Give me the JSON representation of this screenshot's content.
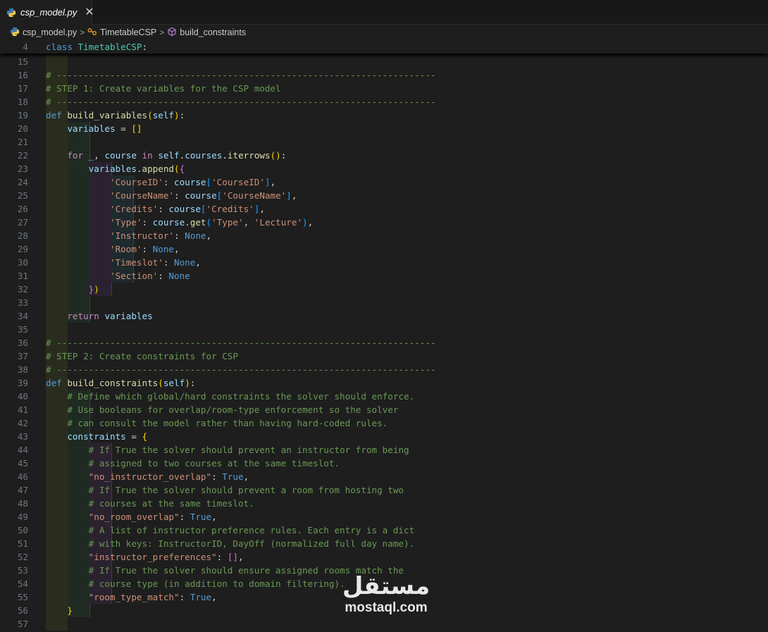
{
  "tab": {
    "label": "csp_model.py",
    "close": "✕"
  },
  "breadcrumb": {
    "file": "csp_model.py",
    "class": "TimetableCSP",
    "method": "build_constraints",
    "separator": ">"
  },
  "sticky": {
    "line": "4",
    "tokens": [
      {
        "t": "class",
        "c": "kw"
      },
      {
        "t": " ",
        "c": "plain"
      },
      {
        "t": "TimetableCSP",
        "c": "cls"
      },
      {
        "t": ":",
        "c": "plain"
      }
    ]
  },
  "editor": {
    "lines": [
      {
        "n": "15",
        "bands": [
          1
        ],
        "tokens": []
      },
      {
        "n": "16",
        "bands": [
          1
        ],
        "tokens": [
          {
            "t": "# -----------------------------------------------------------------------",
            "c": "cm"
          }
        ]
      },
      {
        "n": "17",
        "bands": [
          1
        ],
        "tokens": [
          {
            "t": "# STEP 1: Create variables for the CSP model",
            "c": "cm"
          }
        ]
      },
      {
        "n": "18",
        "bands": [
          1
        ],
        "tokens": [
          {
            "t": "# -----------------------------------------------------------------------",
            "c": "cm"
          }
        ]
      },
      {
        "n": "19",
        "bands": [
          1
        ],
        "tokens": [
          {
            "t": "def",
            "c": "kw"
          },
          {
            "t": " ",
            "c": "plain"
          },
          {
            "t": "build_variables",
            "c": "fn"
          },
          {
            "t": "(",
            "c": "br1"
          },
          {
            "t": "self",
            "c": "var"
          },
          {
            "t": ")",
            "c": "br1"
          },
          {
            "t": ":",
            "c": "plain"
          }
        ]
      },
      {
        "n": "20",
        "bands": [
          1,
          2
        ],
        "tokens": [
          {
            "t": "    ",
            "c": "plain"
          },
          {
            "t": "variables",
            "c": "var"
          },
          {
            "t": " = ",
            "c": "plain"
          },
          {
            "t": "[]",
            "c": "br1"
          }
        ]
      },
      {
        "n": "21",
        "bands": [
          1,
          2
        ],
        "tokens": []
      },
      {
        "n": "22",
        "bands": [
          1,
          2
        ],
        "tokens": [
          {
            "t": "    ",
            "c": "plain"
          },
          {
            "t": "for",
            "c": "ctl"
          },
          {
            "t": " ",
            "c": "plain"
          },
          {
            "t": "_",
            "c": "var"
          },
          {
            "t": ", ",
            "c": "plain"
          },
          {
            "t": "course",
            "c": "var"
          },
          {
            "t": " ",
            "c": "plain"
          },
          {
            "t": "in",
            "c": "ctl"
          },
          {
            "t": " ",
            "c": "plain"
          },
          {
            "t": "self",
            "c": "var"
          },
          {
            "t": ".",
            "c": "plain"
          },
          {
            "t": "courses",
            "c": "var"
          },
          {
            "t": ".",
            "c": "plain"
          },
          {
            "t": "iterrows",
            "c": "fn"
          },
          {
            "t": "()",
            "c": "br1"
          },
          {
            "t": ":",
            "c": "plain"
          }
        ]
      },
      {
        "n": "23",
        "bands": [
          1,
          2,
          3
        ],
        "tokens": [
          {
            "t": "        ",
            "c": "plain"
          },
          {
            "t": "variables",
            "c": "var"
          },
          {
            "t": ".",
            "c": "plain"
          },
          {
            "t": "append",
            "c": "fn"
          },
          {
            "t": "(",
            "c": "br1"
          },
          {
            "t": "{",
            "c": "br2"
          }
        ]
      },
      {
        "n": "24",
        "bands": [
          1,
          2,
          3,
          4
        ],
        "tokens": [
          {
            "t": "            ",
            "c": "plain"
          },
          {
            "t": "'CourseID'",
            "c": "str"
          },
          {
            "t": ": ",
            "c": "plain"
          },
          {
            "t": "course",
            "c": "var"
          },
          {
            "t": "[",
            "c": "br3"
          },
          {
            "t": "'CourseID'",
            "c": "str"
          },
          {
            "t": "]",
            "c": "br3"
          },
          {
            "t": ",",
            "c": "plain"
          }
        ]
      },
      {
        "n": "25",
        "bands": [
          1,
          2,
          3,
          4
        ],
        "tokens": [
          {
            "t": "            ",
            "c": "plain"
          },
          {
            "t": "'CourseName'",
            "c": "str"
          },
          {
            "t": ": ",
            "c": "plain"
          },
          {
            "t": "course",
            "c": "var"
          },
          {
            "t": "[",
            "c": "br3"
          },
          {
            "t": "'CourseName'",
            "c": "str"
          },
          {
            "t": "]",
            "c": "br3"
          },
          {
            "t": ",",
            "c": "plain"
          }
        ]
      },
      {
        "n": "26",
        "bands": [
          1,
          2,
          3,
          4
        ],
        "tokens": [
          {
            "t": "            ",
            "c": "plain"
          },
          {
            "t": "'Credits'",
            "c": "str"
          },
          {
            "t": ": ",
            "c": "plain"
          },
          {
            "t": "course",
            "c": "var"
          },
          {
            "t": "[",
            "c": "br3"
          },
          {
            "t": "'Credits'",
            "c": "str"
          },
          {
            "t": "]",
            "c": "br3"
          },
          {
            "t": ",",
            "c": "plain"
          }
        ]
      },
      {
        "n": "27",
        "bands": [
          1,
          2,
          3,
          4
        ],
        "tokens": [
          {
            "t": "            ",
            "c": "plain"
          },
          {
            "t": "'Type'",
            "c": "str"
          },
          {
            "t": ": ",
            "c": "plain"
          },
          {
            "t": "course",
            "c": "var"
          },
          {
            "t": ".",
            "c": "plain"
          },
          {
            "t": "get",
            "c": "fn"
          },
          {
            "t": "(",
            "c": "br3"
          },
          {
            "t": "'Type'",
            "c": "str"
          },
          {
            "t": ", ",
            "c": "plain"
          },
          {
            "t": "'Lecture'",
            "c": "str"
          },
          {
            "t": ")",
            "c": "br3"
          },
          {
            "t": ",",
            "c": "plain"
          }
        ]
      },
      {
        "n": "28",
        "bands": [
          1,
          2,
          3,
          4
        ],
        "tokens": [
          {
            "t": "            ",
            "c": "plain"
          },
          {
            "t": "'Instructor'",
            "c": "str"
          },
          {
            "t": ": ",
            "c": "plain"
          },
          {
            "t": "None",
            "c": "kw"
          },
          {
            "t": ",",
            "c": "plain"
          }
        ]
      },
      {
        "n": "29",
        "bands": [
          1,
          2,
          3,
          4
        ],
        "tokens": [
          {
            "t": "            ",
            "c": "plain"
          },
          {
            "t": "'Room'",
            "c": "str"
          },
          {
            "t": ": ",
            "c": "plain"
          },
          {
            "t": "None",
            "c": "kw"
          },
          {
            "t": ",",
            "c": "plain"
          }
        ]
      },
      {
        "n": "30",
        "bands": [
          1,
          2,
          3,
          4
        ],
        "tokens": [
          {
            "t": "            ",
            "c": "plain"
          },
          {
            "t": "'Timeslot'",
            "c": "str"
          },
          {
            "t": ": ",
            "c": "plain"
          },
          {
            "t": "None",
            "c": "kw"
          },
          {
            "t": ",",
            "c": "plain"
          }
        ]
      },
      {
        "n": "31",
        "bands": [
          1,
          2,
          3,
          4
        ],
        "tokens": [
          {
            "t": "            ",
            "c": "plain"
          },
          {
            "t": "'Section'",
            "c": "str"
          },
          {
            "t": ": ",
            "c": "plain"
          },
          {
            "t": "None",
            "c": "kw"
          }
        ]
      },
      {
        "n": "32",
        "bands": [
          1,
          2,
          3
        ],
        "tokens": [
          {
            "t": "        ",
            "c": "plain"
          },
          {
            "t": "}",
            "c": "br2"
          },
          {
            "t": ")",
            "c": "br1"
          }
        ]
      },
      {
        "n": "33",
        "bands": [
          1,
          2
        ],
        "tokens": []
      },
      {
        "n": "34",
        "bands": [
          1,
          2
        ],
        "tokens": [
          {
            "t": "    ",
            "c": "plain"
          },
          {
            "t": "return",
            "c": "ctl"
          },
          {
            "t": " ",
            "c": "plain"
          },
          {
            "t": "variables",
            "c": "var"
          }
        ]
      },
      {
        "n": "35",
        "bands": [
          1
        ],
        "tokens": []
      },
      {
        "n": "36",
        "bands": [
          1
        ],
        "tokens": [
          {
            "t": "# -----------------------------------------------------------------------",
            "c": "cm"
          }
        ]
      },
      {
        "n": "37",
        "bands": [
          1
        ],
        "tokens": [
          {
            "t": "# STEP 2: Create constraints for CSP",
            "c": "cm"
          }
        ]
      },
      {
        "n": "38",
        "bands": [
          1
        ],
        "tokens": [
          {
            "t": "# -----------------------------------------------------------------------",
            "c": "cm"
          }
        ]
      },
      {
        "n": "39",
        "bands": [
          1
        ],
        "tokens": [
          {
            "t": "def",
            "c": "kw"
          },
          {
            "t": " ",
            "c": "plain"
          },
          {
            "t": "build_constraints",
            "c": "fn"
          },
          {
            "t": "(",
            "c": "br1"
          },
          {
            "t": "self",
            "c": "var"
          },
          {
            "t": ")",
            "c": "br1"
          },
          {
            "t": ":",
            "c": "plain"
          }
        ]
      },
      {
        "n": "40",
        "bands": [
          1,
          2
        ],
        "tokens": [
          {
            "t": "    ",
            "c": "plain"
          },
          {
            "t": "# Define which global/hard constraints the solver should enforce.",
            "c": "cm"
          }
        ]
      },
      {
        "n": "41",
        "bands": [
          1,
          2
        ],
        "tokens": [
          {
            "t": "    ",
            "c": "plain"
          },
          {
            "t": "# Use booleans for overlap/room-type enforcement so the solver",
            "c": "cm"
          }
        ]
      },
      {
        "n": "42",
        "bands": [
          1,
          2
        ],
        "tokens": [
          {
            "t": "    ",
            "c": "plain"
          },
          {
            "t": "# can consult the model rather than having hard-coded rules.",
            "c": "cm"
          }
        ]
      },
      {
        "n": "43",
        "bands": [
          1,
          2
        ],
        "tokens": [
          {
            "t": "    ",
            "c": "plain"
          },
          {
            "t": "constraints",
            "c": "var"
          },
          {
            "t": " = ",
            "c": "plain"
          },
          {
            "t": "{",
            "c": "br1"
          }
        ]
      },
      {
        "n": "44",
        "bands": [
          1,
          2,
          3
        ],
        "tokens": [
          {
            "t": "        ",
            "c": "plain"
          },
          {
            "t": "# If True the solver should prevent an instructor from being",
            "c": "cm"
          }
        ]
      },
      {
        "n": "45",
        "bands": [
          1,
          2,
          3
        ],
        "tokens": [
          {
            "t": "        ",
            "c": "plain"
          },
          {
            "t": "# assigned to two courses at the same timeslot.",
            "c": "cm"
          }
        ]
      },
      {
        "n": "46",
        "bands": [
          1,
          2,
          3
        ],
        "tokens": [
          {
            "t": "        ",
            "c": "plain"
          },
          {
            "t": "\"no_instructor_overlap\"",
            "c": "str"
          },
          {
            "t": ": ",
            "c": "plain"
          },
          {
            "t": "True",
            "c": "kw"
          },
          {
            "t": ",",
            "c": "plain"
          }
        ]
      },
      {
        "n": "47",
        "bands": [
          1,
          2,
          3
        ],
        "tokens": [
          {
            "t": "        ",
            "c": "plain"
          },
          {
            "t": "# If True the solver should prevent a room from hosting two",
            "c": "cm"
          }
        ]
      },
      {
        "n": "48",
        "bands": [
          1,
          2,
          3
        ],
        "tokens": [
          {
            "t": "        ",
            "c": "plain"
          },
          {
            "t": "# courses at the same timeslot.",
            "c": "cm"
          }
        ]
      },
      {
        "n": "49",
        "bands": [
          1,
          2,
          3
        ],
        "tokens": [
          {
            "t": "        ",
            "c": "plain"
          },
          {
            "t": "\"no_room_overlap\"",
            "c": "str"
          },
          {
            "t": ": ",
            "c": "plain"
          },
          {
            "t": "True",
            "c": "kw"
          },
          {
            "t": ",",
            "c": "plain"
          }
        ]
      },
      {
        "n": "50",
        "bands": [
          1,
          2,
          3
        ],
        "tokens": [
          {
            "t": "        ",
            "c": "plain"
          },
          {
            "t": "# A list of instructor preference rules. Each entry is a dict",
            "c": "cm"
          }
        ]
      },
      {
        "n": "51",
        "bands": [
          1,
          2,
          3
        ],
        "tokens": [
          {
            "t": "        ",
            "c": "plain"
          },
          {
            "t": "# with keys: InstructorID, DayOff (normalized full day name).",
            "c": "cm"
          }
        ]
      },
      {
        "n": "52",
        "bands": [
          1,
          2,
          3
        ],
        "tokens": [
          {
            "t": "        ",
            "c": "plain"
          },
          {
            "t": "\"instructor_preferences\"",
            "c": "str"
          },
          {
            "t": ": ",
            "c": "plain"
          },
          {
            "t": "[]",
            "c": "br2"
          },
          {
            "t": ",",
            "c": "plain"
          }
        ]
      },
      {
        "n": "53",
        "bands": [
          1,
          2,
          3
        ],
        "tokens": [
          {
            "t": "        ",
            "c": "plain"
          },
          {
            "t": "# If True the solver should ensure assigned rooms match the",
            "c": "cm"
          }
        ]
      },
      {
        "n": "54",
        "bands": [
          1,
          2,
          3
        ],
        "tokens": [
          {
            "t": "        ",
            "c": "plain"
          },
          {
            "t": "# course type (in addition to domain filtering).",
            "c": "cm"
          }
        ]
      },
      {
        "n": "55",
        "bands": [
          1,
          2,
          3
        ],
        "tokens": [
          {
            "t": "        ",
            "c": "plain"
          },
          {
            "t": "\"room_type_match\"",
            "c": "str"
          },
          {
            "t": ": ",
            "c": "plain"
          },
          {
            "t": "True",
            "c": "kw"
          },
          {
            "t": ",",
            "c": "plain"
          }
        ]
      },
      {
        "n": "56",
        "bands": [
          1,
          2
        ],
        "tokens": [
          {
            "t": "    ",
            "c": "plain"
          },
          {
            "t": "}",
            "c": "br1"
          }
        ]
      },
      {
        "n": "57",
        "bands": [
          1
        ],
        "tokens": []
      }
    ]
  },
  "watermark": {
    "arabic": "مستقل",
    "latin": "mostaql.com"
  }
}
